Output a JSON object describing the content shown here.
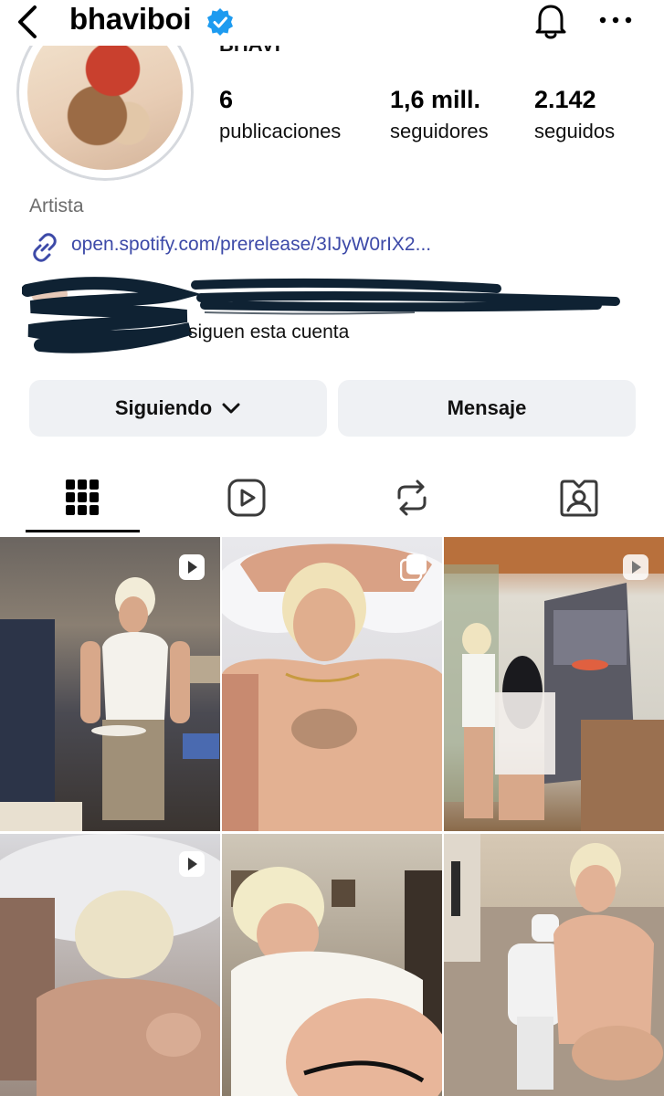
{
  "profile": {
    "username": "bhaviboi",
    "display_name_fragment": "BHAVI",
    "category": "Artista",
    "link": "open.spotify.com/prerelease/3IJyW0rIX2...",
    "followed_by_text": "siguen esta cuenta"
  },
  "stats": [
    {
      "value": "6",
      "label": "publicaciones"
    },
    {
      "value": "1,6 mill.",
      "label": "seguidores"
    },
    {
      "value": "2.142",
      "label": "seguidos"
    }
  ],
  "actions": {
    "following_label": "Siguiendo",
    "message_label": "Mensaje"
  },
  "icons": {
    "back": "chevron-left-icon",
    "verified": "verified-badge-icon",
    "notifications": "bell-icon",
    "more": "more-icon",
    "link": "link-icon"
  },
  "tabs": [
    {
      "name": "grid",
      "icon": "grid-icon",
      "active": true
    },
    {
      "name": "reels",
      "icon": "reels-icon",
      "active": false
    },
    {
      "name": "reposts",
      "icon": "repost-icon",
      "active": false
    },
    {
      "name": "tagged",
      "icon": "tagged-icon",
      "active": false
    }
  ],
  "posts": [
    {
      "badge": "reel"
    },
    {
      "badge": "carousel"
    },
    {
      "badge": "reel"
    },
    {
      "badge": "reel"
    },
    {
      "badge": "none"
    },
    {
      "badge": "none"
    }
  ],
  "colors": {
    "verified_blue": "#1d9bf0",
    "link_blue": "#3d4aa8",
    "button_bg": "#eff1f4",
    "secondary_text": "#6b6b6b"
  }
}
